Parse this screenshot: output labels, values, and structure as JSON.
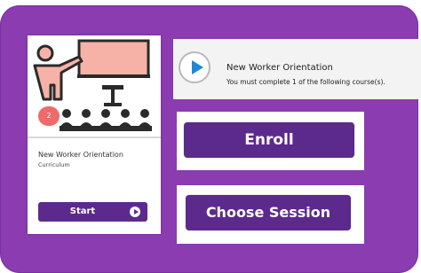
{
  "course_card": {
    "badge_count": "2",
    "title": "New Worker Orientation",
    "subtitle": "Curriculum",
    "start_label": "Start"
  },
  "info": {
    "title": "New Worker Orientation",
    "subtitle": "You must complete 1 of the following course(s)."
  },
  "actions": {
    "enroll_label": "Enroll",
    "choose_session_label": "Choose Session"
  },
  "colors": {
    "panel": "#8a3cb0",
    "button": "#5c2a8c",
    "play_icon": "#1e88d8",
    "badge": "#f06a6a"
  }
}
